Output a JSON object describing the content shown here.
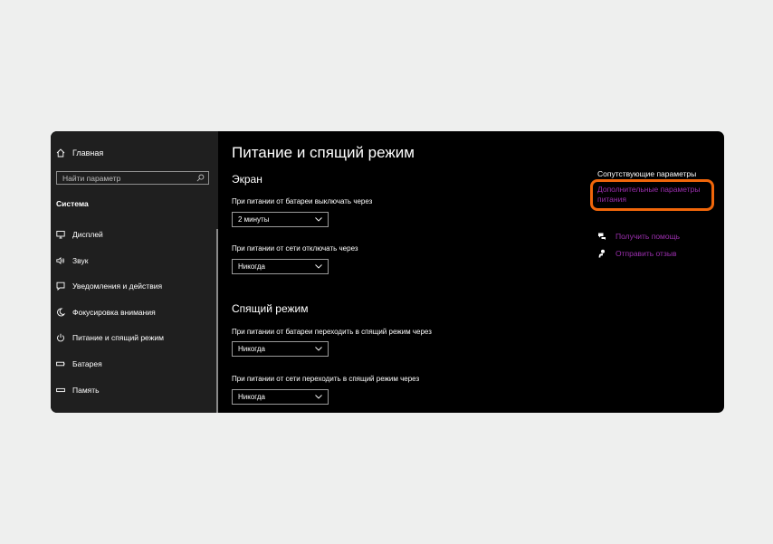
{
  "sidebar": {
    "home_label": "Главная",
    "search_placeholder": "Найти параметр",
    "section_title": "Система",
    "items": [
      {
        "label": "Дисплей",
        "icon": "monitor-icon"
      },
      {
        "label": "Звук",
        "icon": "speaker-icon"
      },
      {
        "label": "Уведомления и действия",
        "icon": "notification-icon"
      },
      {
        "label": "Фокусировка внимания",
        "icon": "moon-icon"
      },
      {
        "label": "Питание и спящий режим",
        "icon": "power-icon"
      },
      {
        "label": "Батарея",
        "icon": "battery-icon"
      },
      {
        "label": "Память",
        "icon": "storage-icon"
      }
    ]
  },
  "main": {
    "title": "Питание и спящий режим",
    "screen": {
      "heading": "Экран",
      "battery_label": "При питании от батареи выключать через",
      "battery_value": "2 минуты",
      "plugged_label": "При питании от сети отключать через",
      "plugged_value": "Никогда"
    },
    "sleep": {
      "heading": "Спящий режим",
      "battery_label": "При питании от батареи переходить в спящий режим через",
      "battery_value": "Никогда",
      "plugged_label": "При питании от сети переходить в спящий режим через",
      "plugged_value": "Никогда"
    }
  },
  "related": {
    "heading": "Сопутствующие параметры",
    "link": "Дополнительные параметры питания",
    "help_label": "Получить помощь",
    "feedback_label": "Отправить отзыв"
  },
  "colors": {
    "accent_link": "#9b2fae",
    "highlight": "#f0660a",
    "sidebar_bg": "#1f1f1f",
    "content_bg": "#000000"
  }
}
